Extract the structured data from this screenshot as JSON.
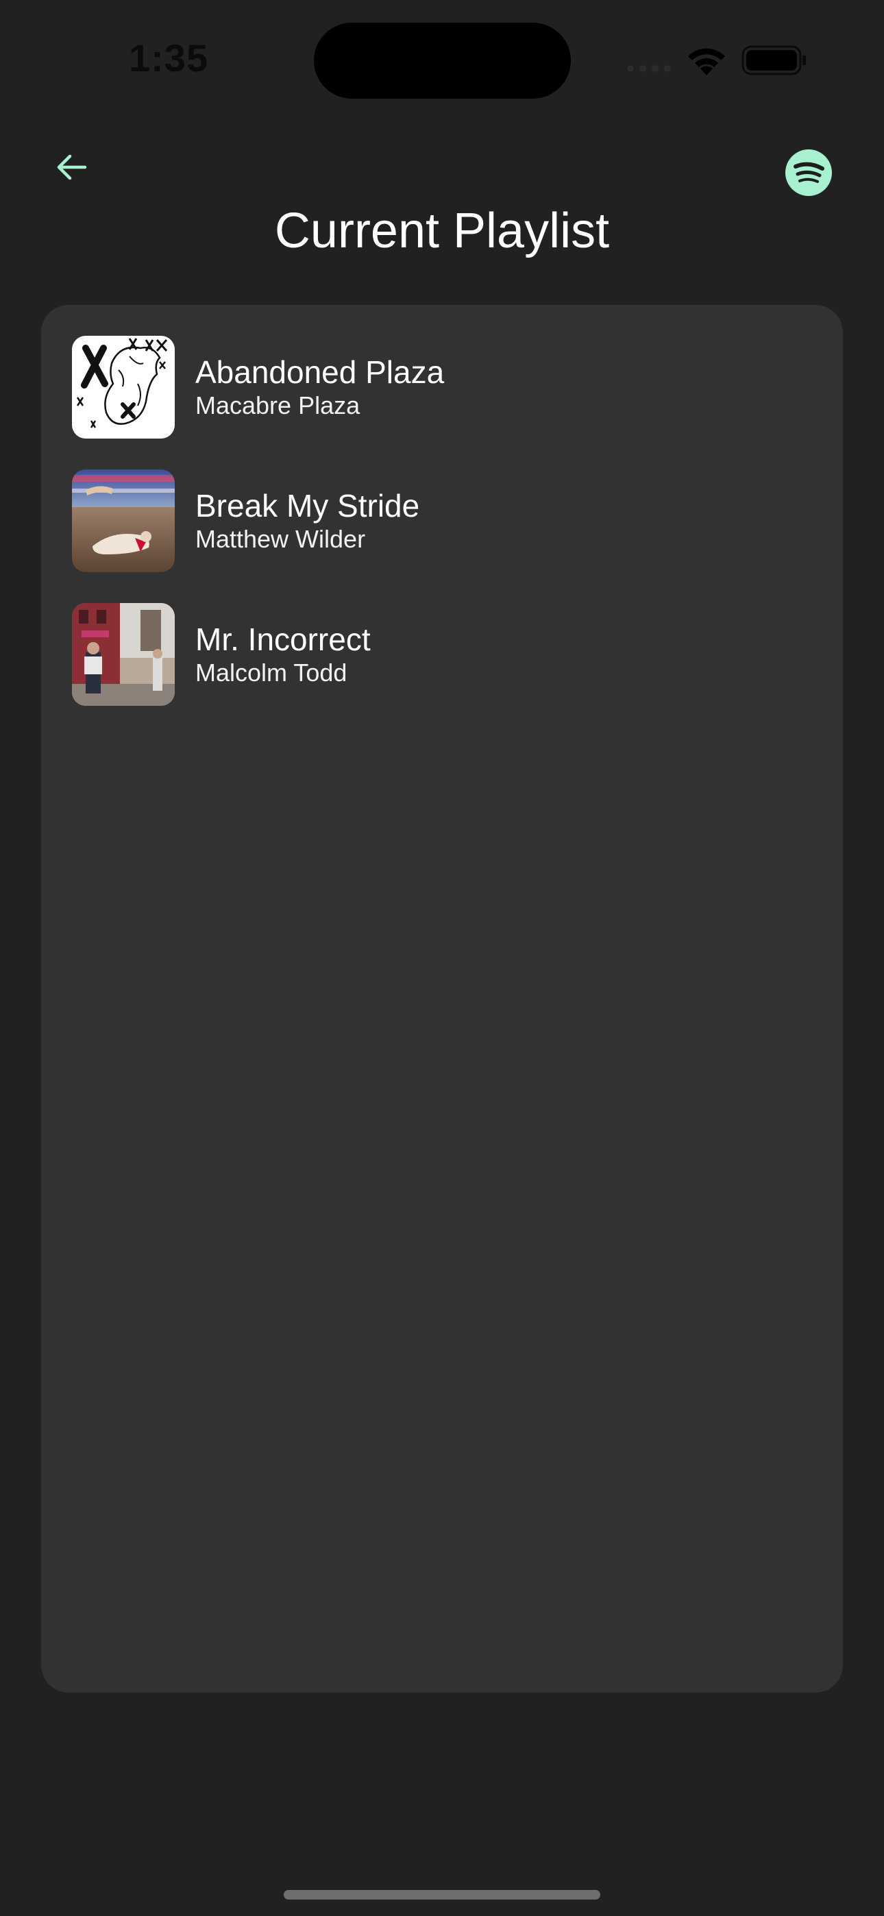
{
  "status_bar": {
    "time": "1:35"
  },
  "header": {
    "title": "Current Playlist",
    "back_icon": "arrow-left-icon",
    "spotify_icon": "spotify-icon",
    "accent_color": "#a7f0d0"
  },
  "tracks": [
    {
      "title": "Abandoned Plaza",
      "artist": "Macabre Plaza"
    },
    {
      "title": "Break My Stride",
      "artist": "Matthew Wilder"
    },
    {
      "title": "Mr. Incorrect",
      "artist": "Malcolm Todd"
    }
  ]
}
